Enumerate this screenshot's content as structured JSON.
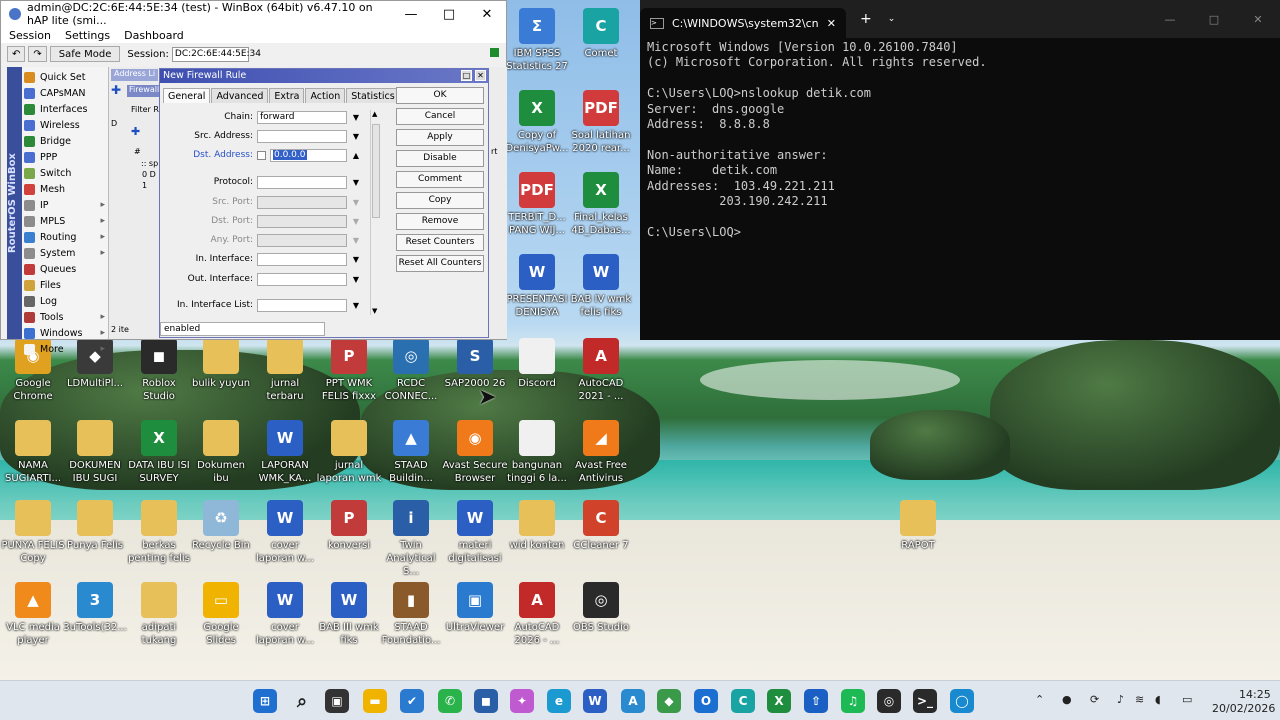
{
  "winbox": {
    "title": "admin@DC:2C:6E:44:5E:34 (test) - WinBox (64bit) v6.47.10 on hAP lite (smi...",
    "menu": [
      "Session",
      "Settings",
      "Dashboard"
    ],
    "safe_mode": "Safe Mode",
    "session_label": "Session:",
    "session_value": "DC:2C:6E:44:5E:34",
    "sidebar_brand": "RouterOS WinBox",
    "sidebar": [
      {
        "label": "Quick Set",
        "color": "#d98c1f",
        "arrow": ""
      },
      {
        "label": "CAPsMAN",
        "color": "#4a6fd1",
        "arrow": ""
      },
      {
        "label": "Interfaces",
        "color": "#2d8a3a",
        "arrow": ""
      },
      {
        "label": "Wireless",
        "color": "#4a6fd1",
        "arrow": ""
      },
      {
        "label": "Bridge",
        "color": "#2d8a3a",
        "arrow": ""
      },
      {
        "label": "PPP",
        "color": "#4a6fd1",
        "arrow": ""
      },
      {
        "label": "Switch",
        "color": "#7aa84a",
        "arrow": ""
      },
      {
        "label": "Mesh",
        "color": "#d0423b",
        "arrow": ""
      },
      {
        "label": "IP",
        "color": "#8c8c8c",
        "arrow": "▸"
      },
      {
        "label": "MPLS",
        "color": "#8c8c8c",
        "arrow": "▸"
      },
      {
        "label": "Routing",
        "color": "#3b7fd1",
        "arrow": "▸"
      },
      {
        "label": "System",
        "color": "#8c8c8c",
        "arrow": "▸"
      },
      {
        "label": "Queues",
        "color": "#c23b3b",
        "arrow": ""
      },
      {
        "label": "Files",
        "color": "#d0a23b",
        "arrow": ""
      },
      {
        "label": "Log",
        "color": "#666",
        "arrow": ""
      },
      {
        "label": "Tools",
        "color": "#b03b3b",
        "arrow": "▸"
      },
      {
        "label": "Windows",
        "color": "#3b6fd1",
        "arrow": "▸"
      },
      {
        "label": "More",
        "color": "#f4f4f4",
        "arrow": "▸"
      }
    ],
    "bg_tabs": {
      "address": "Address Li",
      "firewall": "Firewall",
      "filter": "Filter R",
      "d": "D",
      "hash": "#",
      "row1": ":: sp",
      "row2": "0 D",
      "row3": "1",
      "items": "2 ite",
      "rt": "rt"
    }
  },
  "dialog": {
    "title": "New Firewall Rule",
    "tabs": [
      "General",
      "Advanced",
      "Extra",
      "Action",
      "Statistics"
    ],
    "fields": {
      "chain_label": "Chain:",
      "chain_value": "forward",
      "src_label": "Src. Address:",
      "dst_label": "Dst. Address:",
      "dst_value": "0.0.0.0",
      "protocol_label": "Protocol:",
      "src_port_label": "Src. Port:",
      "dst_port_label": "Dst. Port:",
      "any_port_label": "Any. Port:",
      "in_if_label": "In. Interface:",
      "out_if_label": "Out. Interface:",
      "in_if_list_label": "In. Interface List:"
    },
    "buttons": [
      "OK",
      "Cancel",
      "Apply",
      "Disable",
      "Comment",
      "Copy",
      "Remove",
      "Reset Counters",
      "Reset All Counters"
    ],
    "status": "enabled"
  },
  "cmd": {
    "tab_title": "C:\\WINDOWS\\system32\\cn",
    "lines": [
      "Microsoft Windows [Version 10.0.26100.7840]",
      "(c) Microsoft Corporation. All rights reserved.",
      "",
      "C:\\Users\\LOQ>nslookup detik.com",
      "Server:  dns.google",
      "Address:  8.8.8.8",
      "",
      "Non-authoritative answer:",
      "Name:    detik.com",
      "Addresses:  103.49.221.211",
      "          203.190.242.211",
      "",
      "C:\\Users\\LOQ>"
    ]
  },
  "desktop_icons": [
    {
      "label": "IBM SPSS Statistics 27",
      "color": "#3a7bd5",
      "glyph": "Σ"
    },
    {
      "label": "Comet",
      "color": "#1aa3a3",
      "glyph": "C"
    },
    {
      "label": "Copy of DenisyaPw...",
      "color": "#1e8e3e",
      "glyph": "X"
    },
    {
      "label": "Soal latihan 2020 rear...",
      "color": "#d23b3b",
      "glyph": "PDF"
    },
    {
      "label": "TERBIT_D... PANG WIJ...",
      "color": "#d23b3b",
      "glyph": "PDF"
    },
    {
      "label": "Final_kelas 4B_Dabas...",
      "color": "#1e8e3e",
      "glyph": "X"
    },
    {
      "label": "PRESENTASI DENISYA",
      "color": "#2b5fc4",
      "glyph": "W"
    },
    {
      "label": "BAB IV wmk felis fiks",
      "color": "#2b5fc4",
      "glyph": "W"
    },
    {
      "label": "Google Chrome",
      "color": "#e0a020",
      "glyph": "◉"
    },
    {
      "label": "LDMultiPl...",
      "color": "#3a3a3a",
      "glyph": "◆"
    },
    {
      "label": "Roblox Studio",
      "color": "#2a2a2a",
      "glyph": "◼"
    },
    {
      "label": "bulik yuyun",
      "color": "#e8c05a",
      "glyph": ""
    },
    {
      "label": "jurnal terbaru",
      "color": "#e8c05a",
      "glyph": ""
    },
    {
      "label": "PPT WMK FELIS fixxx",
      "color": "#c23b3b",
      "glyph": "P"
    },
    {
      "label": "RCDC CONNEC...",
      "color": "#2a6fb0",
      "glyph": "◎"
    },
    {
      "label": "SAP2000 26",
      "color": "#2a5fa8",
      "glyph": "S"
    },
    {
      "label": "Discord",
      "color": "#f0f0f0",
      "glyph": ""
    },
    {
      "label": "AutoCAD 2021 - ...",
      "color": "#c22a2a",
      "glyph": "A"
    },
    {
      "label": "NAMA SUGIARTI...",
      "color": "#e8c05a",
      "glyph": ""
    },
    {
      "label": "DOKUMEN IBU SUGI",
      "color": "#e8c05a",
      "glyph": ""
    },
    {
      "label": "DATA IBU ISI SURVEY",
      "color": "#1e8e3e",
      "glyph": "X"
    },
    {
      "label": "Dokumen ibu",
      "color": "#e8c05a",
      "glyph": ""
    },
    {
      "label": "LAPORAN WMK_KA...",
      "color": "#2b5fc4",
      "glyph": "W"
    },
    {
      "label": "jurnal laporan wmk",
      "color": "#e8c05a",
      "glyph": ""
    },
    {
      "label": "STAAD Buildin...",
      "color": "#3a7bd5",
      "glyph": "▲"
    },
    {
      "label": "Avast Secure Browser",
      "color": "#f07a1a",
      "glyph": "◉"
    },
    {
      "label": "bangunan tinggi 6 la...",
      "color": "#f0f0f0",
      "glyph": ""
    },
    {
      "label": "Avast Free Antivirus",
      "color": "#f07a1a",
      "glyph": "◢"
    },
    {
      "label": "PUNYA FELIS Copy",
      "color": "#e8c05a",
      "glyph": ""
    },
    {
      "label": "Punya Felis",
      "color": "#e8c05a",
      "glyph": ""
    },
    {
      "label": "berkas penting felis",
      "color": "#e8c05a",
      "glyph": ""
    },
    {
      "label": "Recycle Bin",
      "color": "#8fb8d8",
      "glyph": "♻"
    },
    {
      "label": "cover laporan w...",
      "color": "#2b5fc4",
      "glyph": "W"
    },
    {
      "label": "konversi",
      "color": "#c23b3b",
      "glyph": "P"
    },
    {
      "label": "Twin Analytical S...",
      "color": "#2a5fa8",
      "glyph": "i"
    },
    {
      "label": "materi digitalisasi",
      "color": "#2b5fc4",
      "glyph": "W"
    },
    {
      "label": "wid konten",
      "color": "#e8c05a",
      "glyph": ""
    },
    {
      "label": "CCleaner 7",
      "color": "#d0422a",
      "glyph": "C"
    },
    {
      "label": "RAPOT",
      "color": "#e8c05a",
      "glyph": ""
    },
    {
      "label": "VLC media player",
      "color": "#f08a1a",
      "glyph": "▲"
    },
    {
      "label": "3uTools(32...",
      "color": "#2a8ad0",
      "glyph": "3"
    },
    {
      "label": "adipati tukang",
      "color": "#e8c05a",
      "glyph": ""
    },
    {
      "label": "Google Slides",
      "color": "#f0b400",
      "glyph": "▭"
    },
    {
      "label": "cover laporan w...",
      "color": "#2b5fc4",
      "glyph": "W"
    },
    {
      "label": "BAB III wmk fiks",
      "color": "#2b5fc4",
      "glyph": "W"
    },
    {
      "label": "STAAD Foundatio...",
      "color": "#8a5a2a",
      "glyph": "▮"
    },
    {
      "label": "UltraViewer",
      "color": "#2a7ad0",
      "glyph": "▣"
    },
    {
      "label": "AutoCAD 2026 - ...",
      "color": "#c22a2a",
      "glyph": "A"
    },
    {
      "label": "OBS Studio",
      "color": "#2a2a2a",
      "glyph": "◎"
    }
  ],
  "taskbar": {
    "time": "14:25",
    "date": "20/02/2026",
    "apps": [
      {
        "name": "start",
        "color": "#1f6fd1",
        "glyph": "⊞"
      },
      {
        "name": "search",
        "color": "#dfe6ee",
        "glyph": "⌕"
      },
      {
        "name": "task-view",
        "color": "#333",
        "glyph": "▣"
      },
      {
        "name": "file-explorer",
        "color": "#f0b400",
        "glyph": "▬"
      },
      {
        "name": "todo",
        "color": "#2a7ad0",
        "glyph": "✔"
      },
      {
        "name": "whatsapp",
        "color": "#2ab34a",
        "glyph": "✆"
      },
      {
        "name": "store",
        "color": "#2a5fa8",
        "glyph": "◼"
      },
      {
        "name": "copilot",
        "color": "#c05ad0",
        "glyph": "✦"
      },
      {
        "name": "edge",
        "color": "#1a9ad0",
        "glyph": "e"
      },
      {
        "name": "word",
        "color": "#2b5fc4",
        "glyph": "W"
      },
      {
        "name": "autocad",
        "color": "#2a8ad0",
        "glyph": "A"
      },
      {
        "name": "android-studio",
        "color": "#3a9a4a",
        "glyph": "◆"
      },
      {
        "name": "outlook",
        "color": "#1a6fd0",
        "glyph": "O"
      },
      {
        "name": "comet",
        "color": "#1aa3a3",
        "glyph": "C"
      },
      {
        "name": "excel",
        "color": "#1e8e3e",
        "glyph": "X"
      },
      {
        "name": "uploader",
        "color": "#1a5fc4",
        "glyph": "⇧"
      },
      {
        "name": "spotify",
        "color": "#1db954",
        "glyph": "♫"
      },
      {
        "name": "obs",
        "color": "#2a2a2a",
        "glyph": "◎"
      },
      {
        "name": "terminal",
        "color": "#2a2a2a",
        "glyph": ">_"
      },
      {
        "name": "winbox",
        "color": "#1a8ad0",
        "glyph": "◯"
      }
    ]
  }
}
